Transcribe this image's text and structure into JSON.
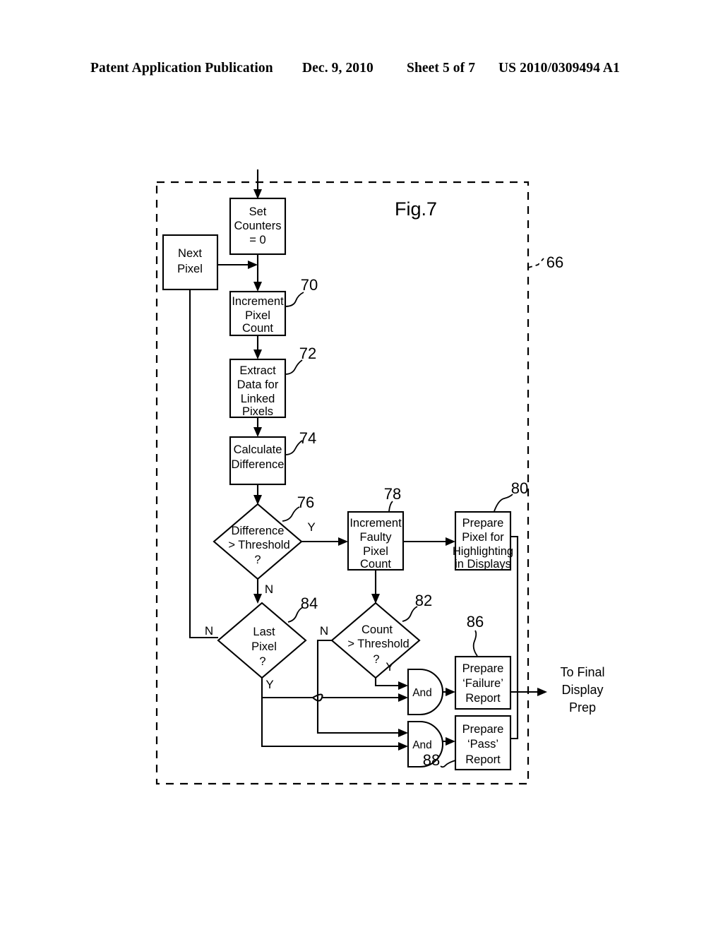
{
  "header": {
    "publication": "Patent Application Publication",
    "date": "Dec. 9, 2010",
    "sheet": "Sheet 5 of 7",
    "number": "US 2010/0309494 A1"
  },
  "figure": {
    "title": "Fig.7",
    "boundary_ref": "66",
    "nodes": {
      "set_counters": {
        "lines": [
          "Set",
          "Counters",
          "= 0"
        ]
      },
      "next_pixel": {
        "lines": [
          "Next",
          "Pixel"
        ]
      },
      "increment_pixel_count": {
        "lines": [
          "Increment",
          "Pixel",
          "Count"
        ],
        "ref": "70"
      },
      "extract_data": {
        "lines": [
          "Extract",
          "Data for",
          "Linked",
          "Pixels"
        ],
        "ref": "72"
      },
      "calculate_difference": {
        "lines": [
          "Calculate",
          "Difference"
        ],
        "ref": "74"
      },
      "difference_threshold": {
        "lines": [
          "Difference",
          "> Threshold",
          "?"
        ],
        "ref": "76"
      },
      "increment_faulty": {
        "lines": [
          "Increment",
          "Faulty",
          "Pixel",
          "Count"
        ],
        "ref": "78"
      },
      "prepare_highlight": {
        "lines": [
          "Prepare",
          "Pixel for",
          "Highlighting",
          "in Displays"
        ],
        "ref": "80"
      },
      "count_threshold": {
        "lines": [
          "Count",
          "> Threshold",
          "?"
        ],
        "ref": "82"
      },
      "last_pixel": {
        "lines": [
          "Last",
          "Pixel",
          "?"
        ],
        "ref": "84"
      },
      "failure_report": {
        "lines": [
          "Prepare",
          "‘Failure’",
          "Report"
        ],
        "ref": "86"
      },
      "pass_report": {
        "lines": [
          "Prepare",
          "‘Pass’",
          "Report"
        ],
        "ref": "88"
      },
      "and_gate_top": {
        "label": "And"
      },
      "and_gate_bottom": {
        "label": "And"
      },
      "final_output": {
        "lines": [
          "To Final",
          "Display",
          "Prep"
        ]
      }
    },
    "edge_labels": {
      "difference_yes": "Y",
      "difference_no": "N",
      "last_pixel_no": "N",
      "last_pixel_yes": "Y",
      "count_no": "N",
      "count_yes": "Y"
    }
  }
}
